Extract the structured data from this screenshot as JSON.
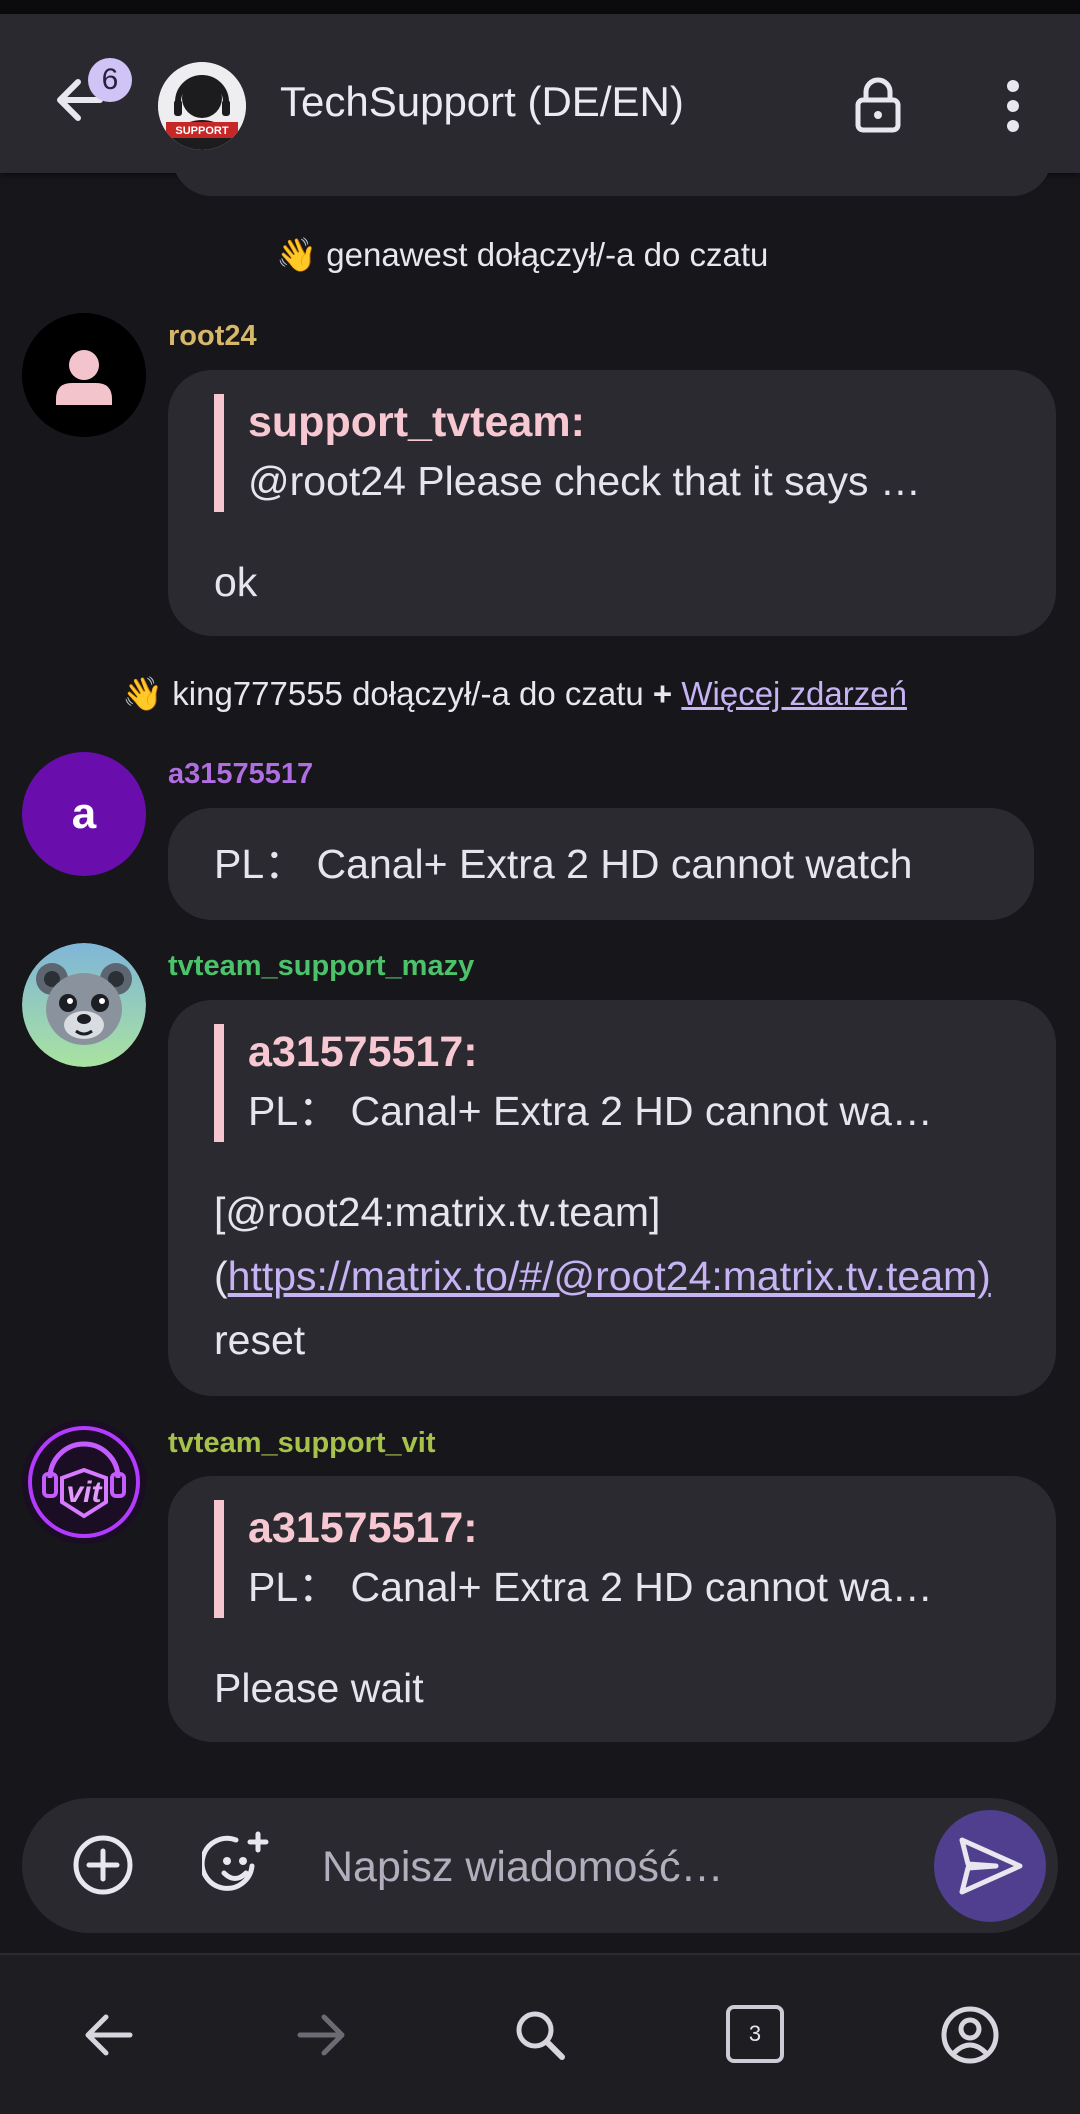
{
  "header": {
    "back_badge": "6",
    "room_title": "TechSupport (DE/EN)",
    "room_avatar_text": "SUPPORT"
  },
  "events": {
    "join_1": "👋 genawest dołączył/-a do czatu",
    "join_2_text": "👋 king777555 dołączył/-a do czatu",
    "join_2_plus": "+",
    "more_events": "Więcej zdarzeń"
  },
  "messages": [
    {
      "sender": "root24",
      "sender_color": "#d6b86a",
      "avatar": "person-icon",
      "reply_name": "support_tvteam:",
      "reply_text": "@root24 Please check that it says …",
      "body": "ok"
    },
    {
      "sender": "a31575517",
      "sender_color": "#b06ee0",
      "avatar_letter": "a",
      "body": "PL： Canal+ Extra 2 HD cannot watch"
    },
    {
      "sender": "tvteam_support_mazy",
      "sender_color": "#4cc36a",
      "avatar": "bear-robot-avatar",
      "reply_name": "a31575517:",
      "reply_text": "PL： Canal+ Extra 2 HD cannot wa…",
      "body_prefix": "[@root24:matrix.tv.team](",
      "body_link": "https://matrix.to/#/@root24:matrix.tv.team)",
      "body_suffix": "reset"
    },
    {
      "sender": "tvteam_support_vit",
      "sender_color": "#a6c24a",
      "avatar": "vit-neon-logo",
      "reply_name": "a31575517:",
      "reply_text": "PL： Canal+ Extra 2 HD cannot wa…",
      "body": "Please wait"
    }
  ],
  "composer": {
    "placeholder": "Napisz wiadomość…"
  },
  "navbar": {
    "tabs_count": "3"
  },
  "colors": {
    "background": "#17161b",
    "bubble": "#2b2a31",
    "accent": "#4f3f8e",
    "reply_bar": "#f5c6cf",
    "link": "#c5b3f4"
  }
}
